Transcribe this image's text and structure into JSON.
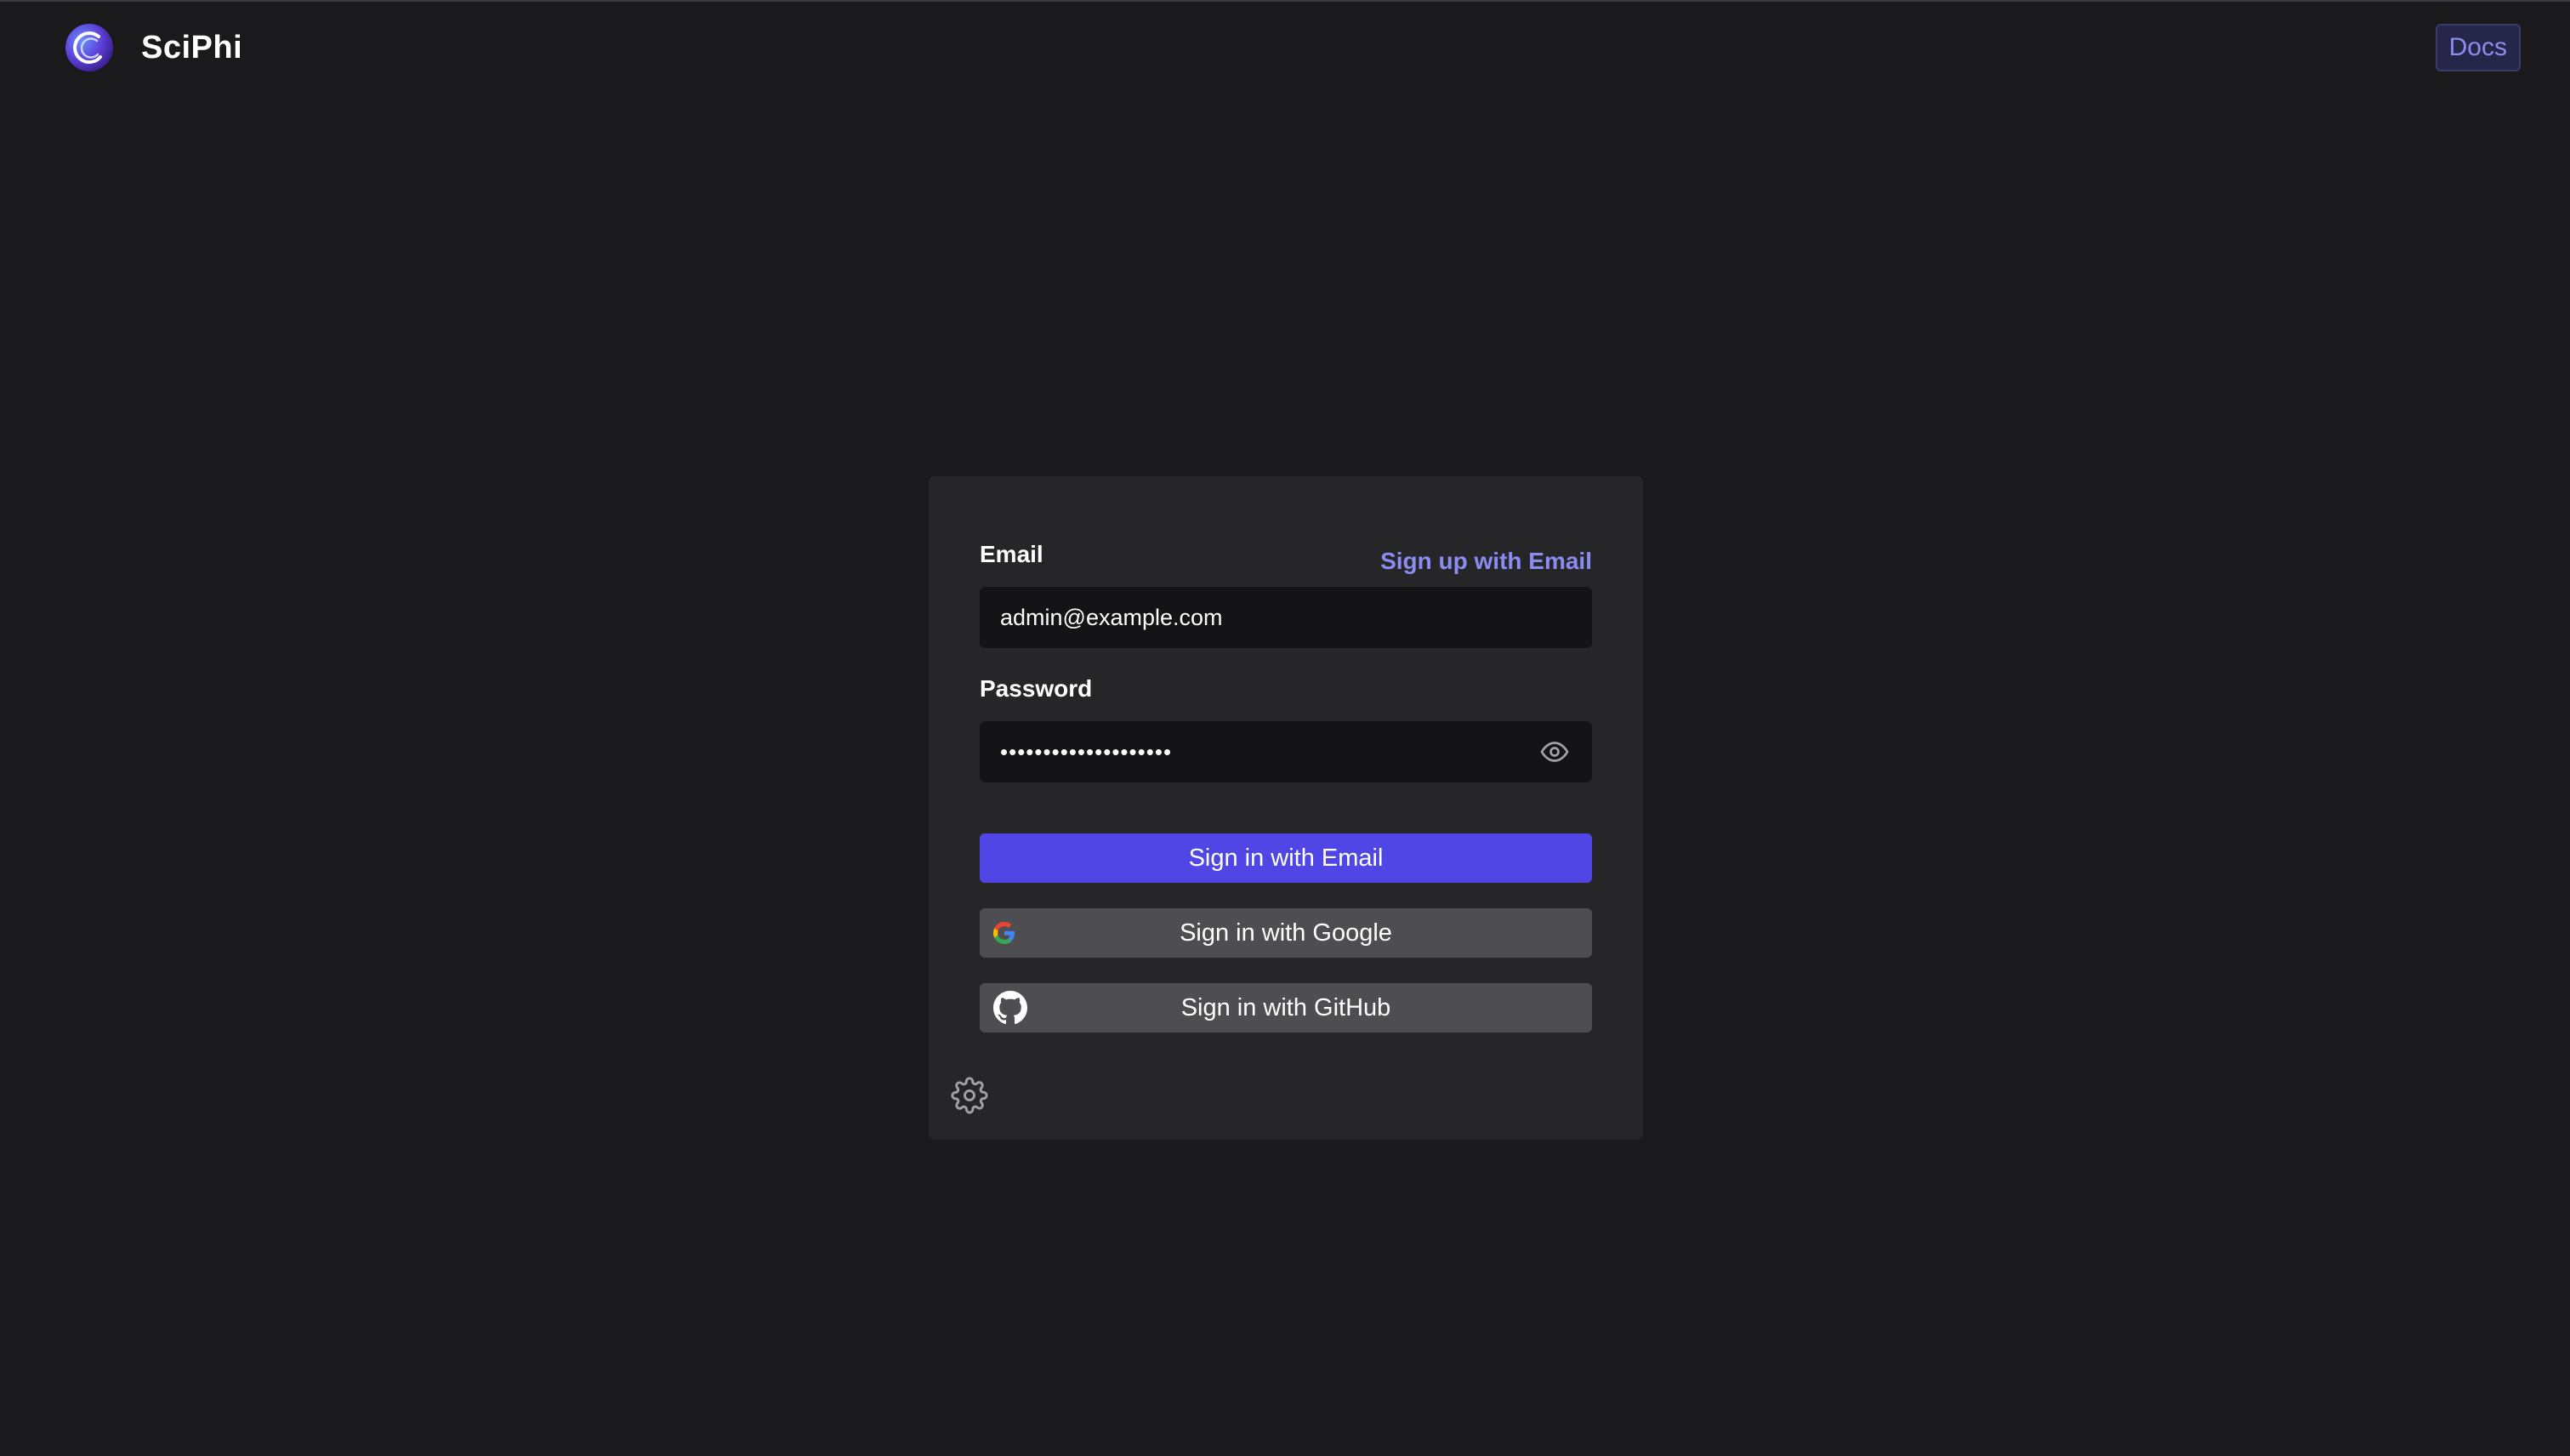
{
  "header": {
    "brand_name": "SciPhi",
    "docs_label": "Docs"
  },
  "login": {
    "email_label": "Email",
    "signup_link": "Sign up with Email",
    "email_value": "admin@example.com",
    "password_label": "Password",
    "password_value": "••••••••••••••••••••",
    "sign_in_email": "Sign in with Email",
    "sign_in_google": "Sign in with Google",
    "sign_in_github": "Sign in with GitHub"
  },
  "icons": {
    "logo": "sciphi-logo-icon",
    "password_toggle": "eye-icon",
    "google": "google-icon",
    "github": "github-icon",
    "settings": "gear-icon"
  },
  "colors": {
    "background": "#1a1a1c",
    "card": "#262628",
    "accent": "#4f46e5",
    "link": "#8a8cf0",
    "secondary_button": "#4e4e52"
  }
}
